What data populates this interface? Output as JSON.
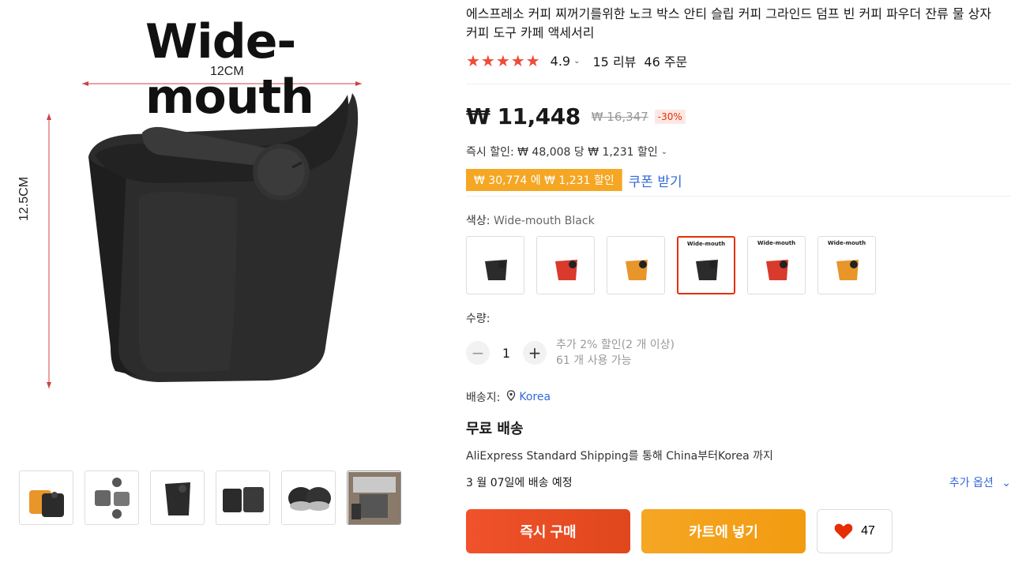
{
  "gallery": {
    "overlay_title": "Wide-mouth",
    "width_label": "12CM",
    "height_label": "12.5CM",
    "thumbnails": [
      "thumb-1",
      "thumb-2",
      "thumb-3",
      "thumb-4",
      "thumb-5",
      "thumb-6"
    ]
  },
  "product": {
    "title": "에스프레소 커피 찌꺼기를위한 노크 박스 안티 슬립 커피 그라인드 덤프 빈 커피 파우더 잔류 물 상자 커피 도구 카페 액세서리",
    "rating": "4.9",
    "reviews": "15 리뷰",
    "orders": "46 주문",
    "star_color": "#ee4b39"
  },
  "pricing": {
    "price": "₩ 11,448",
    "old_price": "₩ 16,347",
    "discount": "-30%",
    "instant_discount": "즉시 할인: ₩ 48,008 당 ₩ 1,231 할인",
    "coupon_tag": "₩ 30,774 에 ₩ 1,231 할인",
    "coupon_link": "쿠폰 받기"
  },
  "options": {
    "color_label": "색상:",
    "color_value": "Wide-mouth Black",
    "swatches": [
      {
        "color": "#2b2b2b",
        "label": ""
      },
      {
        "color": "#d93a2b",
        "label": ""
      },
      {
        "color": "#e8952a",
        "label": ""
      },
      {
        "color": "#2b2b2b",
        "label": "Wide-mouth"
      },
      {
        "color": "#d93a2b",
        "label": "Wide-mouth"
      },
      {
        "color": "#e8952a",
        "label": "Wide-mouth"
      }
    ],
    "selected_index": 3
  },
  "quantity": {
    "label": "수량:",
    "value": "1",
    "note_line1": "추가 2% 할인(2 개 이상)",
    "note_line2": "61 개 사용 가능"
  },
  "shipping": {
    "label": "배송지:",
    "location": "Korea",
    "free": "무료 배송",
    "detail": "AliExpress Standard Shipping를 통해 China부터Korea 까지",
    "date": "3 월 07일에 배송 예정",
    "more_options": "추가 옵션"
  },
  "actions": {
    "buy": "즉시 구매",
    "cart": "카트에 넣기",
    "wishlist_count": "47"
  }
}
